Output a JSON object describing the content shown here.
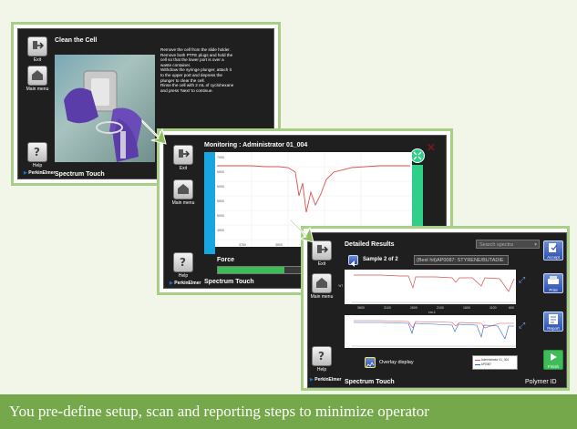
{
  "caption": "You pre-define setup, scan and reporting steps to minimize operator",
  "screen1": {
    "title": "Clean the Cell",
    "exit_label": "Exit",
    "main_menu_label": "Main menu",
    "help_label": "Help",
    "logo_brand": "PerkinElmer",
    "footer": "Spectrum Touch",
    "instructions": "Remove the cell from the slide holder.\nRemove both PTFE plugs and hold the\ncell so that the lower port is over a\nwaste container.\nWithdraw the syringe plunger, attach it\nto the upper port and depress the\nplunger to clear the cell.\nRinse the cell with 2 mL of cyclohexane\nand press 'Next' to continue."
  },
  "screen2": {
    "title": "Monitoring : Administrator 01_004",
    "exit_label": "Exit",
    "main_menu_label": "Main menu",
    "help_label": "Help",
    "logo_brand": "PerkinElmer",
    "footer": "Spectrum Touch",
    "force_label": "Force",
    "force_level": 0.73,
    "y_ticks": [
      "7000",
      "6500",
      "6000",
      "5500",
      "5000",
      "4500"
    ],
    "x_ticks": [
      "3750",
      "3500",
      "3250",
      "3000",
      "2750"
    ],
    "colors": {
      "left_band": "#18a6e0",
      "right_band": "#2fcf8a",
      "trace": "#d9534f"
    }
  },
  "screen3": {
    "title": "Detailed Results",
    "search_placeholder": "Search spectra",
    "sample_label": "Sample 2 of 2",
    "best_hit": "(Best hit)AP0087: STYRENE/BUTADIE",
    "overlay_label": "Overlay display",
    "legend": [
      "Administrator 01_004",
      "AP0087"
    ],
    "x_ticks": [
      "3600",
      "3100",
      "2600",
      "2100",
      "1600",
      "1100",
      "600"
    ],
    "x_unit": "cm-1",
    "y_unit": "%T",
    "buttons": {
      "accept": "Accept",
      "print": "Print",
      "report": "Report",
      "finish": "Finish"
    },
    "exit_label": "Exit",
    "main_menu_label": "Main menu",
    "help_label": "Help",
    "logo_brand": "PerkinElmer",
    "footer": "Spectrum Touch",
    "product": "Polymer ID",
    "colors": {
      "trace_red": "#d9534f",
      "trace_blue": "#2f5fd0"
    }
  }
}
